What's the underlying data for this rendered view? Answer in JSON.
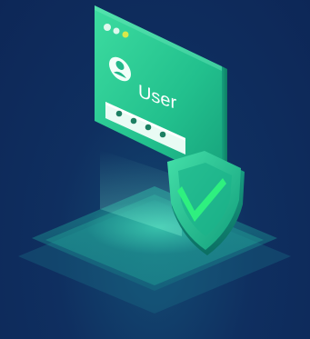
{
  "login_card": {
    "username_label": "User",
    "password_mask": "• • • •"
  },
  "colors": {
    "background": "#0f2a5c",
    "card_front": "#2bcf96",
    "card_side": "#129a78",
    "shield": "#27c98f",
    "check": "#1fe07a",
    "platform": "#1a8f88"
  },
  "icons": [
    "window-dots-icon",
    "user-avatar-icon",
    "password-field",
    "shield-check-icon"
  ]
}
